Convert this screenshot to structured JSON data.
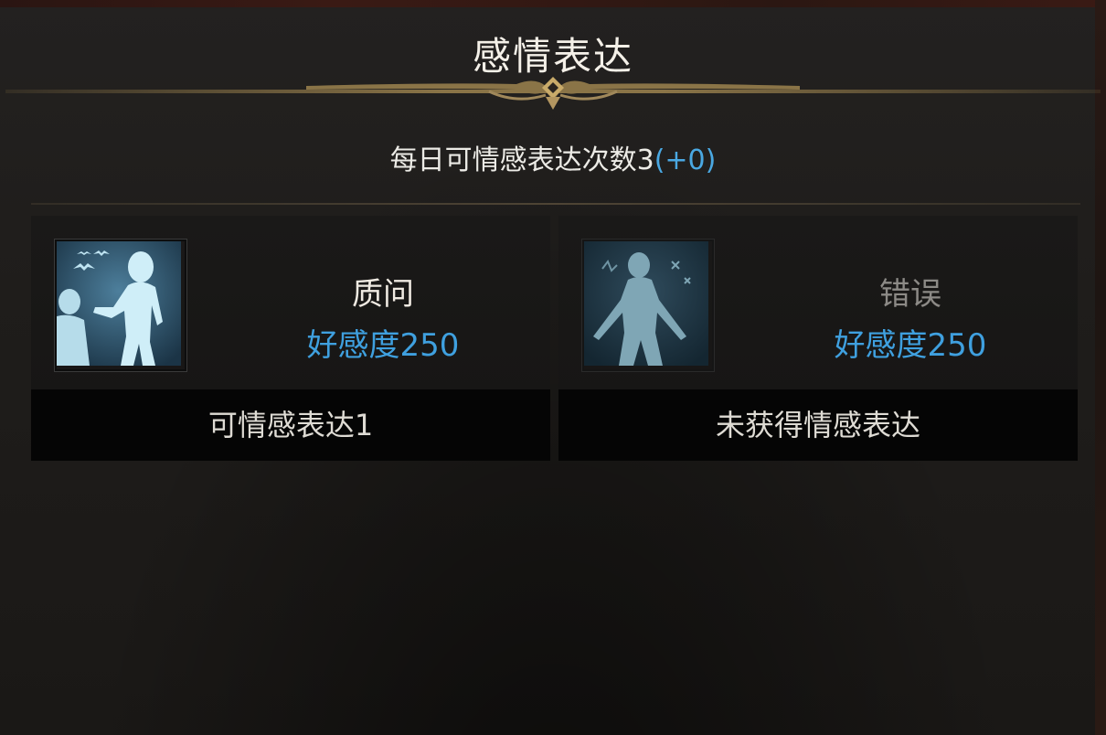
{
  "header": {
    "title": "感情表达"
  },
  "daily": {
    "label": "每日可情感表达次数3",
    "bonus": "(+0)"
  },
  "cards": [
    {
      "name": "质问",
      "favor": "好感度250",
      "status": "可情感表达1",
      "icon": "interrogate-emote-icon"
    },
    {
      "name": "错误",
      "favor": "好感度250",
      "status": "未获得情感表达",
      "icon": "mistake-emote-icon"
    }
  ],
  "colors": {
    "accent_blue": "#3fa0df",
    "gold_trim": "#8a7447",
    "panel_bg": "#1f1d1b"
  }
}
